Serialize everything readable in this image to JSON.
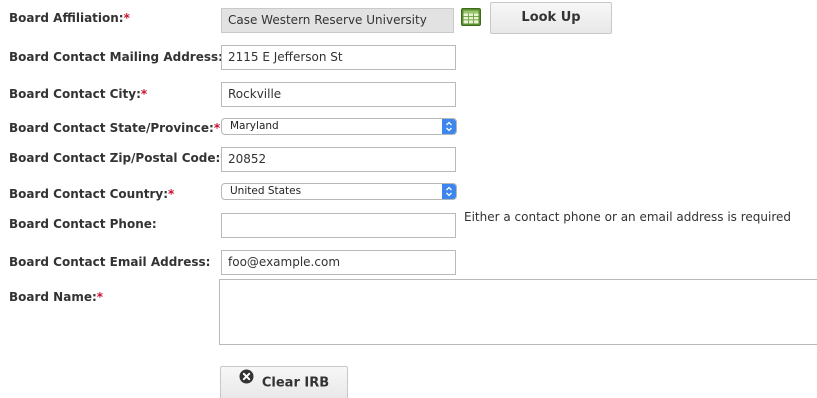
{
  "form": {
    "affiliation": {
      "label": "Board Affiliation:",
      "required_mark": "*",
      "value": "Case Western Reserve University"
    },
    "lookup_button": {
      "label": "Look Up"
    },
    "mailing_address": {
      "label": "Board Contact Mailing Address:",
      "required_mark": "*",
      "value": "2115 E Jefferson St"
    },
    "city": {
      "label": "Board Contact City:",
      "required_mark": "*",
      "value": "Rockville"
    },
    "state": {
      "label": "Board Contact State/Province:",
      "required_mark": "*",
      "selected": "Maryland"
    },
    "zip": {
      "label": "Board Contact Zip/Postal Code:",
      "required_mark": "*",
      "value": "20852"
    },
    "country": {
      "label": "Board Contact Country:",
      "required_mark": "*",
      "selected": "United States"
    },
    "phone": {
      "label": "Board Contact Phone:",
      "value": "",
      "hint": "Either a contact phone or an email address is required"
    },
    "email": {
      "label": "Board Contact Email Address:",
      "value": "foo@example.com"
    },
    "board_name": {
      "label": "Board Name:",
      "required_mark": "*",
      "value": ""
    },
    "clear_button": {
      "label": "Clear IRB",
      "icon": "close-circle-icon"
    }
  },
  "colors": {
    "required": "#c8102e",
    "select_accent": "#3d86ee",
    "readonly_bg": "#e2e2e2"
  }
}
